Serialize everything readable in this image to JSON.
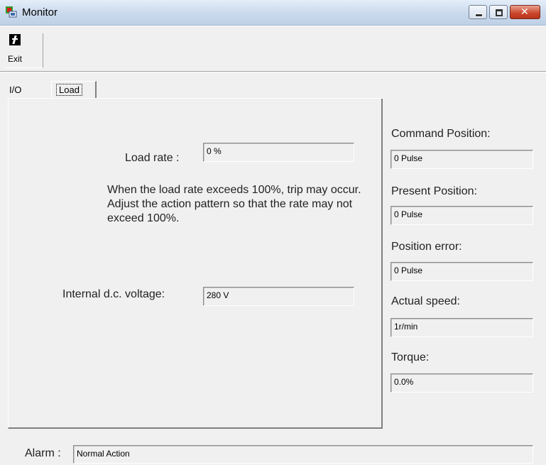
{
  "window": {
    "title": "Monitor"
  },
  "toolbar": {
    "exit_label": "Exit"
  },
  "tabs": [
    {
      "label": "I/O",
      "active": false
    },
    {
      "label": "Load",
      "active": true
    }
  ],
  "load_panel": {
    "load_rate_label": "Load rate :",
    "load_rate_value": "0 %",
    "note": "When the load rate exceeds 100%, trip may occur. Adjust the action pattern so that the rate may not exceed 100%.",
    "voltage_label": "Internal d.c. voltage:",
    "voltage_value": "280 V"
  },
  "monitors": [
    {
      "label": "Command Position:",
      "value": "0 Pulse"
    },
    {
      "label": "Present Position:",
      "value": "0 Pulse"
    },
    {
      "label": "Position error:",
      "value": "0 Pulse"
    },
    {
      "label": "Actual speed:",
      "value": "1r/min"
    },
    {
      "label": "Torque:",
      "value": "0.0%"
    }
  ],
  "alarm": {
    "label": "Alarm :",
    "value": "Normal Action"
  }
}
